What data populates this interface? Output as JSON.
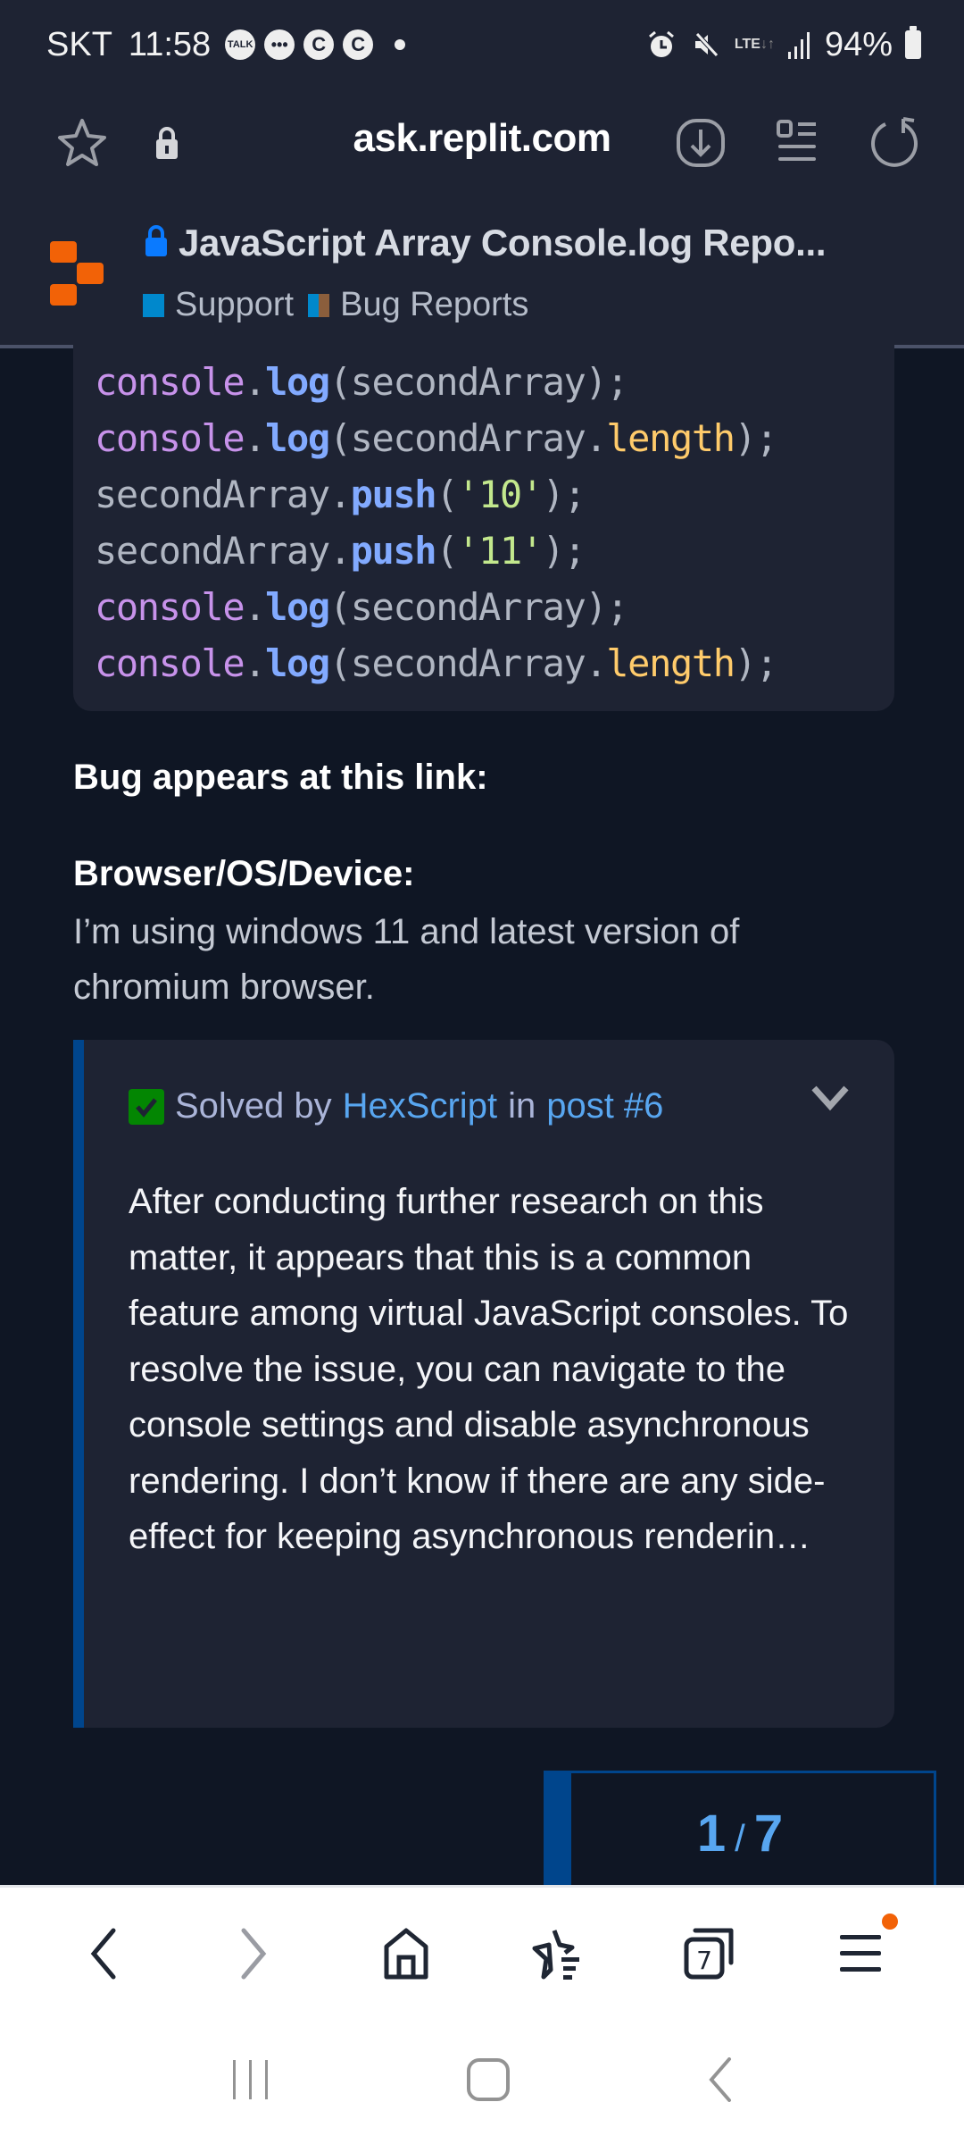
{
  "status_bar": {
    "carrier": "SKT",
    "time": "11:58",
    "notifications": [
      "talk-icon",
      "chat-bubble-icon",
      "c-icon",
      "c-icon"
    ],
    "talk_label": "TALK",
    "c_label": "C",
    "network": "LTE",
    "battery": "94%"
  },
  "browser": {
    "url": "ask.replit.com",
    "tab_count": "7"
  },
  "site": {
    "title": "JavaScript Array Console.log Repo...",
    "categories": [
      {
        "label": "Support",
        "color": "#0088cc"
      },
      {
        "label": "Bug Reports",
        "color_a": "#0088cc",
        "color_b": "#8b5e3c"
      }
    ],
    "brand_color": "#f26207"
  },
  "code": {
    "lines": [
      [
        {
          "t": "console",
          "c": "obj"
        },
        {
          "t": "."
        },
        {
          "t": "log",
          "c": "fn"
        },
        {
          "t": "(secondArray);"
        }
      ],
      [
        {
          "t": "console",
          "c": "obj"
        },
        {
          "t": "."
        },
        {
          "t": "log",
          "c": "fn"
        },
        {
          "t": "(secondArray."
        },
        {
          "t": "length",
          "c": "prop"
        },
        {
          "t": ");"
        }
      ],
      [
        {
          "t": "secondArray."
        },
        {
          "t": "push",
          "c": "fn"
        },
        {
          "t": "("
        },
        {
          "t": "'10'",
          "c": "str"
        },
        {
          "t": ");"
        }
      ],
      [
        {
          "t": "secondArray."
        },
        {
          "t": "push",
          "c": "fn"
        },
        {
          "t": "("
        },
        {
          "t": "'11'",
          "c": "str"
        },
        {
          "t": ");"
        }
      ],
      [
        {
          "t": "console",
          "c": "obj"
        },
        {
          "t": "."
        },
        {
          "t": "log",
          "c": "fn"
        },
        {
          "t": "(secondArray);"
        }
      ],
      [
        {
          "t": "console",
          "c": "obj"
        },
        {
          "t": "."
        },
        {
          "t": "log",
          "c": "fn"
        },
        {
          "t": "(secondArray."
        },
        {
          "t": "length",
          "c": "prop"
        },
        {
          "t": ");"
        }
      ]
    ]
  },
  "post": {
    "bug_link_heading": "Bug appears at this link:",
    "device_heading": "Browser/OS/Device:",
    "device_text": "I’m using windows 11 and latest version of chromium browser."
  },
  "solution": {
    "solved_by_prefix": "Solved by",
    "author": "HexScript",
    "in_label": "in",
    "post_link": "post #6",
    "excerpt": "After conducting further research on this matter, it appears that this is a common feature among virtual JavaScript consoles. To resolve the issue, you can navigate to the console settings and disable asynchronous rendering. I don’t know if there are any side-effect for keeping asynchronous renderin…"
  },
  "timeline": {
    "current": "1",
    "separator": "/",
    "total": "7",
    "progress_fraction": 0.143
  },
  "bottom_bar": {
    "items": [
      "back",
      "forward",
      "home",
      "bookmarks",
      "tabs",
      "menu"
    ]
  }
}
